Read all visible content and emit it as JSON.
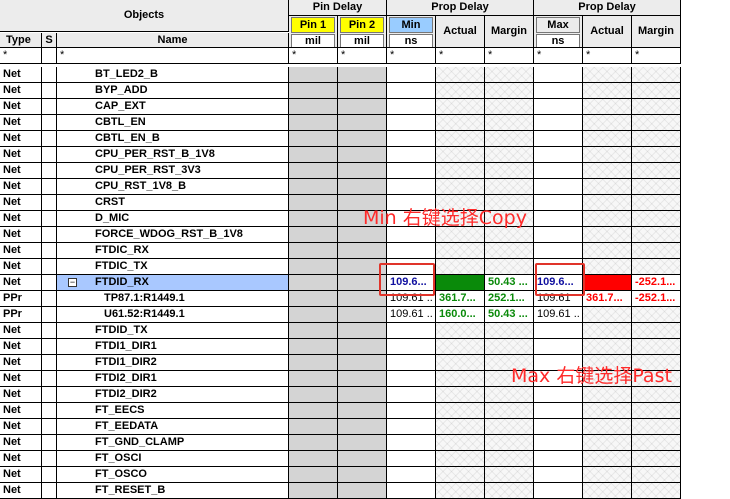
{
  "header": {
    "objects": "Objects",
    "pin_delay": "Pin Delay",
    "prop_delay_1": "Prop Delay",
    "prop_delay_2": "Prop Delay",
    "pin1": "Pin 1",
    "pin2": "Pin 2",
    "min": "Min",
    "max": "Max",
    "actual_1": "Actual",
    "margin_1": "Margin",
    "actual_2": "Actual",
    "margin_2": "Margin",
    "type": "Type",
    "s": "S",
    "name": "Name",
    "unit_mil_1": "mil",
    "unit_mil_2": "mil",
    "unit_ns_1": "ns",
    "unit_ns_2": "ns",
    "filter": "*"
  },
  "rows": [
    {
      "type": "Net",
      "name": "BT_LED2_B"
    },
    {
      "type": "Net",
      "name": "BYP_ADD"
    },
    {
      "type": "Net",
      "name": "CAP_EXT"
    },
    {
      "type": "Net",
      "name": "CBTL_EN"
    },
    {
      "type": "Net",
      "name": "CBTL_EN_B"
    },
    {
      "type": "Net",
      "name": "CPU_PER_RST_B_1V8"
    },
    {
      "type": "Net",
      "name": "CPU_PER_RST_3V3"
    },
    {
      "type": "Net",
      "name": "CPU_RST_1V8_B"
    },
    {
      "type": "Net",
      "name": "CRST"
    },
    {
      "type": "Net",
      "name": "D_MIC"
    },
    {
      "type": "Net",
      "name": "FORCE_WDOG_RST_B_1V8"
    },
    {
      "type": "Net",
      "name": "FTDIC_RX"
    },
    {
      "type": "Net",
      "name": "FTDIC_TX"
    },
    {
      "type": "Net",
      "name": "FTDID_RX",
      "selected": true,
      "expander": "−",
      "min": "109.6...",
      "margin": "50.43 ...",
      "max": "109.6...",
      "margin2": "-252.1..."
    },
    {
      "type": "PPr",
      "name": "TP87.1:R1449.1",
      "sub": true,
      "min": "109.61 ..",
      "actual": "361.7...",
      "margin": "252.1...",
      "max": "109.61",
      "actual2": "361.7...",
      "margin2": "-252.1..."
    },
    {
      "type": "PPr",
      "name": "U61.52:R1449.1",
      "sub": true,
      "min": "109.61 ..",
      "actual": "160.0...",
      "margin": "50.43 ...",
      "max": "109.61 .."
    },
    {
      "type": "Net",
      "name": "FTDID_TX"
    },
    {
      "type": "Net",
      "name": "FTDI1_DIR1"
    },
    {
      "type": "Net",
      "name": "FTDI1_DIR2"
    },
    {
      "type": "Net",
      "name": "FTDI2_DIR1"
    },
    {
      "type": "Net",
      "name": "FTDI2_DIR2"
    },
    {
      "type": "Net",
      "name": "FT_EECS"
    },
    {
      "type": "Net",
      "name": "FT_EEDATA"
    },
    {
      "type": "Net",
      "name": "FT_GND_CLAMP"
    },
    {
      "type": "Net",
      "name": "FT_OSCI"
    },
    {
      "type": "Net",
      "name": "FT_OSCO"
    },
    {
      "type": "Net",
      "name": "FT_RESET_B"
    }
  ],
  "annotations": {
    "min_note": "Min  右键选择Copy",
    "max_note": "Max 右键选择Past"
  },
  "colors": {
    "pin_yellow": "#ffff00",
    "min_blue": "#99ccff",
    "selected_row": "#a9c8ff",
    "pass_green": "#0a8a0a",
    "fail_red": "#ff0000",
    "annotation_red": "#ff2a2a"
  }
}
